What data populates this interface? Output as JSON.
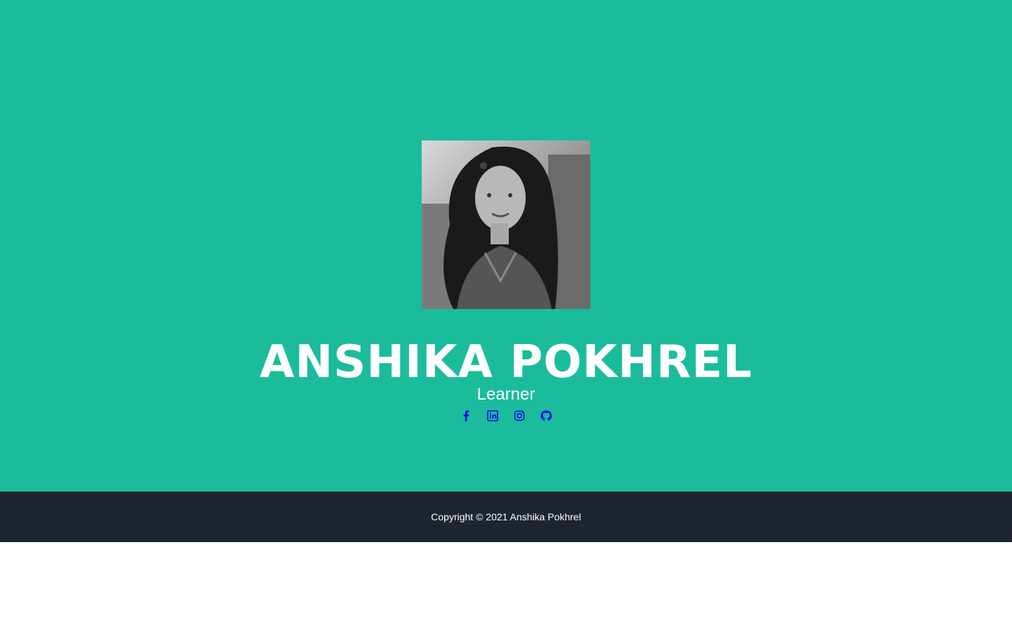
{
  "profile": {
    "name": "ANSHIKA POKHREL",
    "subtitle": "Learner",
    "photo_alt": "Anshika Pokhrel portrait photo"
  },
  "social": [
    {
      "icon": "facebook-icon"
    },
    {
      "icon": "linkedin-icon"
    },
    {
      "icon": "instagram-icon"
    },
    {
      "icon": "github-icon"
    }
  ],
  "footer": {
    "copyright": "Copyright © 2021 Anshika Pokhrel"
  },
  "colors": {
    "masthead_bg": "#1abc9c",
    "footer_bg": "#1e2530",
    "link": "#0000ee",
    "text": "#ffffff"
  }
}
